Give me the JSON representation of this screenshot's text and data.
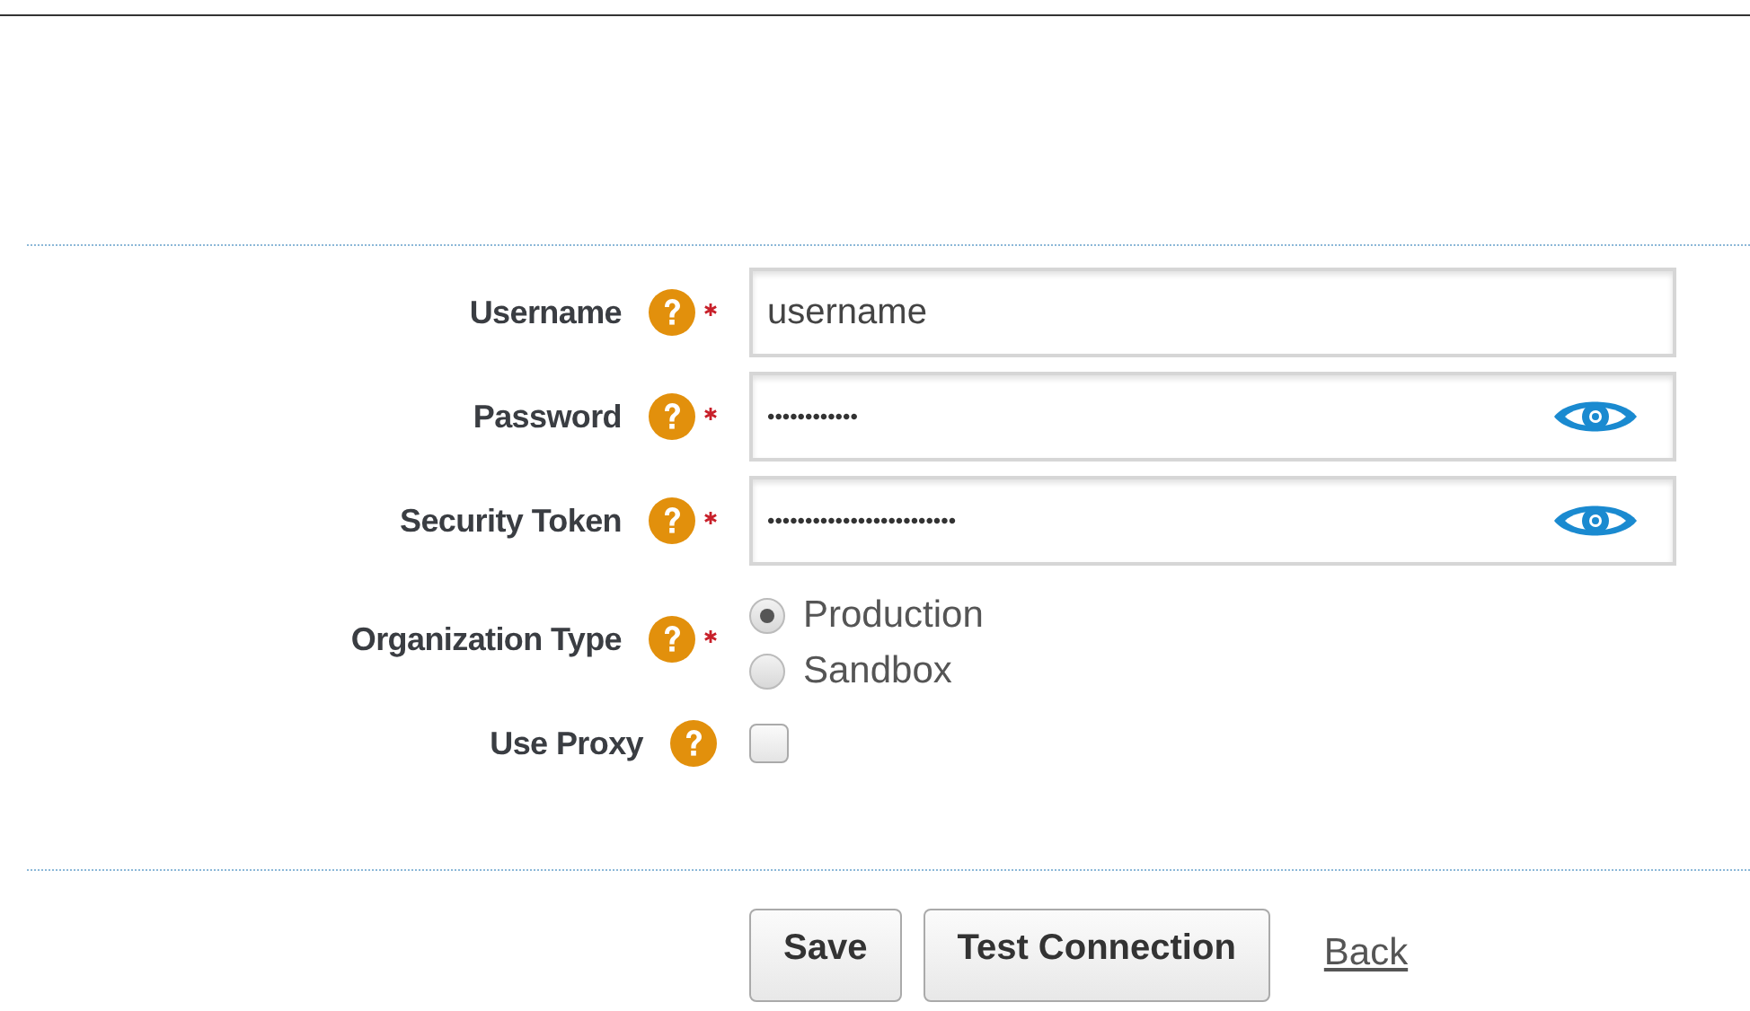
{
  "form": {
    "fields": [
      {
        "kind": "text",
        "label": "Username",
        "required": true,
        "value": "username"
      },
      {
        "kind": "password",
        "label": "Password",
        "required": true,
        "value": "••••••••••••"
      },
      {
        "kind": "password",
        "label": "Security Token",
        "required": true,
        "value": "•••••••••••••••••••••••••"
      },
      {
        "kind": "radio",
        "label": "Organization Type",
        "required": true,
        "options": [
          {
            "label": "Production",
            "selected": true
          },
          {
            "label": "Sandbox",
            "selected": false
          }
        ]
      },
      {
        "kind": "checkbox",
        "label": "Use Proxy",
        "required": false,
        "checked": false
      }
    ]
  },
  "buttons": [
    "Save",
    "Test Connection"
  ],
  "back_link": "Back"
}
